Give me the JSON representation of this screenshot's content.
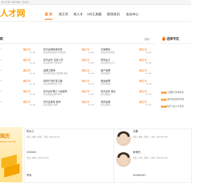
{
  "topbar": {
    "text": "的人才网 | 联系电话 | 请关注..."
  },
  "logo": {
    "text": "人才网"
  },
  "nav": {
    "items": [
      {
        "label": "首 页",
        "active": true
      },
      {
        "label": "找工作",
        "active": false
      },
      {
        "label": "找人才",
        "active": false
      },
      {
        "label": "HR工具箱",
        "active": false
      },
      {
        "label": "职场资讯",
        "active": false
      },
      {
        "label": "会员中心",
        "active": false
      }
    ]
  },
  "jobs_section": {
    "title": "职",
    "more": "更多"
  },
  "jobs": {
    "col1": [
      {
        "title": "…",
        "salary": "面议/月",
        "meta": "…",
        "date": "12-28"
      },
      {
        "title": "…",
        "salary": "面议/月",
        "meta": "…",
        "date": "11-26"
      },
      {
        "title": "…",
        "salary": "面议/月",
        "meta": "…",
        "date": "11-18"
      },
      {
        "title": "…",
        "salary": "面议/月",
        "meta": "…",
        "date": "11-18"
      },
      {
        "title": "…",
        "salary": "面议/月",
        "meta": "…",
        "date": "11-16"
      },
      {
        "title": "…",
        "salary": "面议/月",
        "meta": "…",
        "date": "11-16"
      }
    ],
    "col2": [
      {
        "title": "驻马店律师事务所",
        "salary": "面议/月",
        "meta": "驻马店律所招聘 不限经验",
        "date": "12-28"
      },
      {
        "title": "驻马店市 法务人员",
        "salary": "面议/月",
        "meta": "驻马店律所 不限学历",
        "date": "11-26"
      },
      {
        "title": "监理工程师",
        "salary": "面议/月",
        "meta": "驻马店市建设工程监理 本科",
        "date": "11-18"
      },
      {
        "title": "电商产品开发主管",
        "salary": "面议/月",
        "meta": "驻马店电商科技 大专",
        "date": "11-18"
      },
      {
        "title": "驻马店市第三人民医院",
        "salary": "面议/月",
        "meta": "驻马店医院招聘 本科",
        "date": "11-16"
      },
      {
        "title": "驻马店某某 医师",
        "salary": "面议/月",
        "meta": "驻马店医院 本科",
        "date": "11-16"
      }
    ],
    "col3": [
      {
        "title": "文案策划",
        "salary": "面议/月",
        "meta": "驻马店文化传媒",
        "date": "12-28"
      },
      {
        "title": "财务会计",
        "salary": "面议/月",
        "meta": "驻马店财务公司",
        "date": "11-26"
      },
      {
        "title": "客户经理",
        "salary": "面议/月",
        "meta": "驻马店银行",
        "date": "11-18"
      },
      {
        "title": "营运经理",
        "salary": "面议/月",
        "meta": "驻马店商贸",
        "date": "11-18"
      },
      {
        "title": "驻马店市 医生",
        "salary": "面议/月",
        "meta": "驻马店医院",
        "date": "11-16"
      },
      {
        "title": "电商运营",
        "salary": "面议/月",
        "meta": "驻马店电商",
        "date": "11-16"
      }
    ]
  },
  "side": {
    "title": "选择专区",
    "items": [
      {
        "tag": "HOT",
        "text": "工程部门管理专区"
      },
      {
        "tag": "NEW",
        "text": "教育培训招聘专区"
      },
      {
        "tag": "HOT",
        "text": "医疗卫生人才专区"
      }
    ]
  },
  "resume_banner": {
    "title": "简历",
    "subtitle": "NEWEST RESUME"
  },
  "resumes": [
    {
      "name": "陈女士",
      "info": "专员 | 本科 | 经验：不限 | 2024-07-05"
    },
    {
      "name": "石磊",
      "info": "专员 | 本科 | 经验：1-3年 | 2024-07-05"
    },
    {
      "name": "500000",
      "info": "专员 | 本科 | 2024-07-05"
    },
    {
      "name": "彭明杰",
      "info": "专员 | 大专 | 经验：3-5年 | 2024-07-05"
    },
    {
      "name": "李伟",
      "info": "专员 | 本科 | 2024-07-04"
    },
    {
      "name": "50000007",
      "info": "专员 | 本科 | 2024-07-04"
    }
  ]
}
